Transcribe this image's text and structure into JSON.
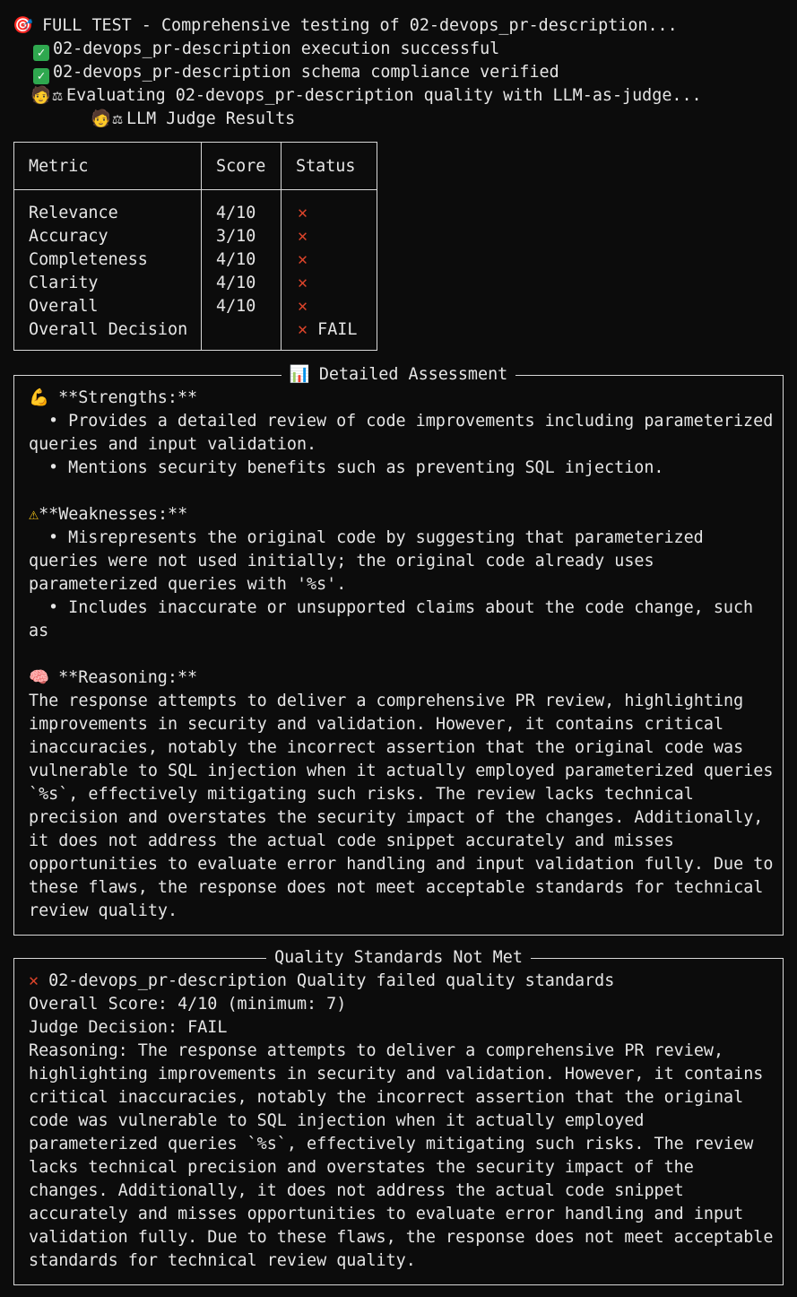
{
  "header": {
    "full_test_icon": "direct-hit-icon",
    "full_test": "FULL TEST - Comprehensive testing of 02-devops_pr-description...",
    "exec_ok": "02-devops_pr-description execution successful",
    "schema_ok": "02-devops_pr-description schema compliance verified",
    "evaluating_icon": "judge-icon",
    "evaluating": "Evaluating 02-devops_pr-description quality with LLM-as-judge...",
    "results_title": "LLM Judge Results"
  },
  "judge_table": {
    "columns": [
      "Metric",
      "Score",
      "Status"
    ],
    "rows": [
      {
        "metric": "Relevance",
        "score": "4/10",
        "status": ""
      },
      {
        "metric": "Accuracy",
        "score": "3/10",
        "status": ""
      },
      {
        "metric": "Completeness",
        "score": "4/10",
        "status": ""
      },
      {
        "metric": "Clarity",
        "score": "4/10",
        "status": ""
      },
      {
        "metric": "Overall",
        "score": "4/10",
        "status": ""
      },
      {
        "metric": "Overall Decision",
        "score": "",
        "status": "FAIL"
      }
    ]
  },
  "assessment": {
    "title": "Detailed Assessment",
    "strengths_header": "**Strengths:**",
    "strengths": [
      [
        "• Provides a detailed review of code improvements including parameterized",
        "queries and input validation."
      ],
      [
        "• Mentions security benefits such as preventing SQL injection."
      ]
    ],
    "weaknesses_header": "**Weaknesses:**",
    "weaknesses": [
      [
        "• Misrepresents the original code by suggesting that parameterized",
        "queries were not used initially; the original code already uses",
        "parameterized queries with '%s'."
      ],
      [
        "• Includes inaccurate or unsupported claims about the code change, such",
        "as"
      ]
    ],
    "reasoning_header": "**Reasoning:**",
    "reasoning_lines": [
      "The response attempts to deliver a comprehensive PR review, highlighting",
      "improvements in security and validation. However, it contains critical",
      "inaccuracies, notably the incorrect assertion that the original code was",
      "vulnerable to SQL injection when it actually employed parameterized queries",
      "`%s`, effectively mitigating such risks. The review lacks technical",
      "precision and overstates the security impact of the changes. Additionally,",
      "it does not address the actual code snippet accurately and misses",
      "opportunities to evaluate error handling and input validation fully. Due to",
      "these flaws, the response does not meet acceptable standards for technical",
      "review quality."
    ]
  },
  "quality": {
    "title": "Quality Standards Not Met",
    "failed_line": "02-devops_pr-description Quality failed quality standards",
    "overall_score": "Overall Score: 4/10 (minimum: 7)",
    "judge_decision": "Judge Decision: FAIL",
    "reasoning_lines": [
      "Reasoning: The response attempts to deliver a comprehensive PR review,",
      "highlighting improvements in security and validation. However, it contains",
      "critical inaccuracies, notably the incorrect assertion that the original",
      "code was vulnerable to SQL injection when it actually employed",
      "parameterized queries `%s`, effectively mitigating such risks. The review",
      "lacks technical precision and overstates the security impact of the",
      "changes. Additionally, it does not address the actual code snippet",
      "accurately and misses opportunities to evaluate error handling and input",
      "validation fully. Due to these flaws, the response does not meet acceptable",
      "standards for technical review quality."
    ]
  },
  "colors": {
    "background": "#0c0c0c",
    "text": "#e6e6e6",
    "fail": "#e0452b",
    "success": "#2fa84f"
  }
}
